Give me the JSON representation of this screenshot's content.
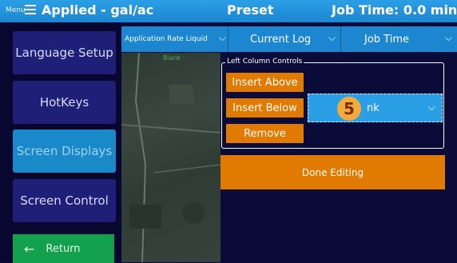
{
  "header": {
    "menu_label": "Menu",
    "title": "Applied - gal/ac",
    "center_label": "Preset",
    "job_time": "Job Time: 0.0 min"
  },
  "sidebar": {
    "items": [
      {
        "label": "Language Setup"
      },
      {
        "label": "HotKeys"
      },
      {
        "label": "Screen Displays"
      },
      {
        "label": "Screen Control"
      }
    ],
    "return_label": "Return"
  },
  "tabs": [
    {
      "label": "Application Rate Liquid"
    },
    {
      "label": "Current Log"
    },
    {
      "label": "Job Time"
    }
  ],
  "map": {
    "blank_label": "Blank"
  },
  "panel": {
    "title": "Left Column Controls",
    "insert_above": "Insert Above",
    "insert_below": "Insert Below",
    "remove": "Remove",
    "select_value": "nk",
    "step_number": "5"
  },
  "done_label": "Done Editing",
  "colors": {
    "accent": "#1d86d0",
    "orange": "#e07a00",
    "green": "#13a14e",
    "background": "#0b0b3a"
  }
}
